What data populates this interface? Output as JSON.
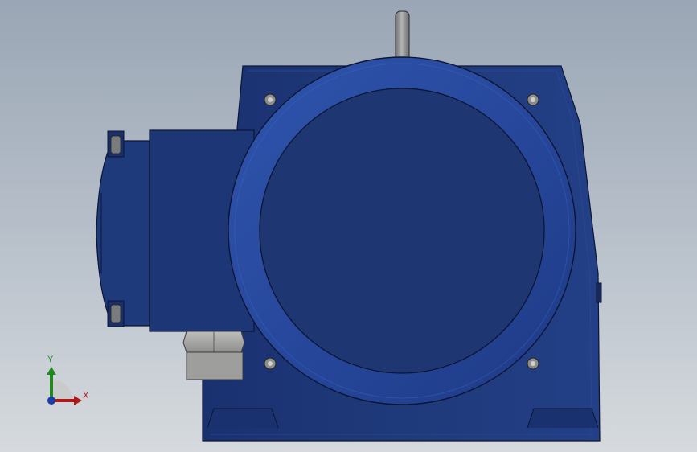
{
  "viewport": {
    "background_top": "#9aa6b5",
    "background_bottom": "#d6dade"
  },
  "model": {
    "part": "worm-gear-reducer",
    "body_color": "#1f3a7a",
    "body_dark": "#16295a",
    "flange_color": "#28499b",
    "shaft_color": "#8e8f91",
    "nut_color": "#a9aaa8"
  },
  "triad": {
    "y_label": "Y",
    "x_label": "X",
    "y_color": "#1e8a1e",
    "x_color": "#b01818",
    "z_color": "#1c3aa8"
  }
}
